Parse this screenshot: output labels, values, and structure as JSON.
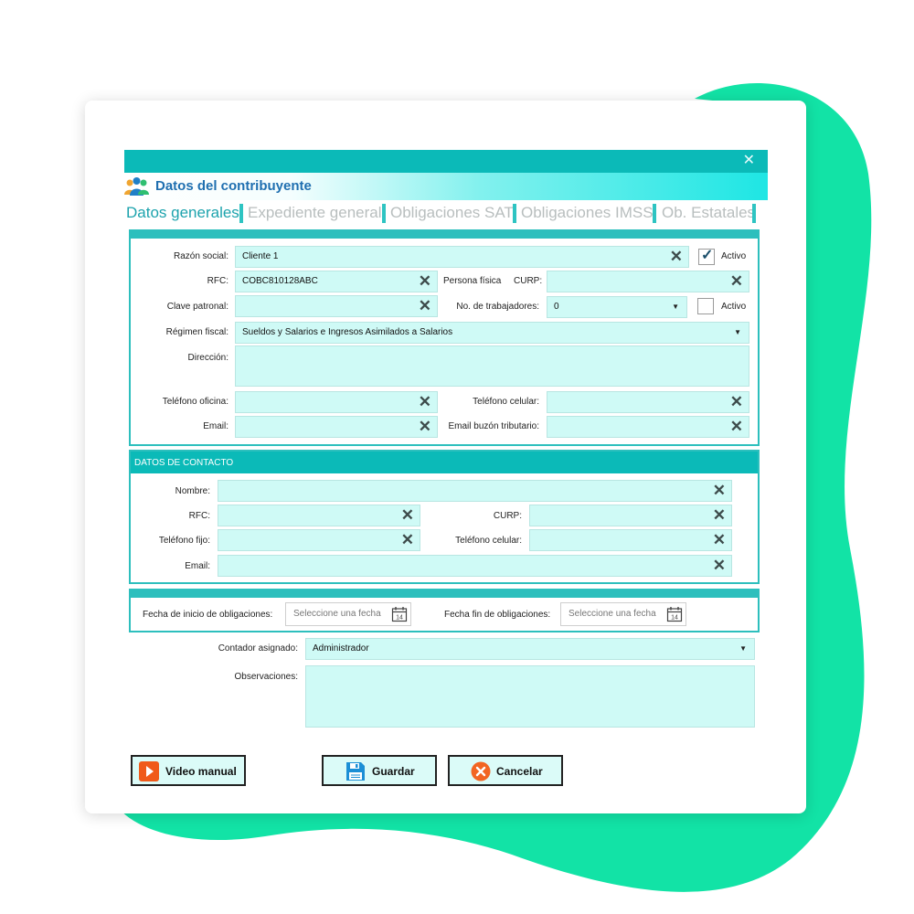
{
  "colors": {
    "accent": "#0bbab8",
    "field_bg": "#cffaf6",
    "blob": "#12e3a6",
    "title_blue": "#1f6fb0"
  },
  "window": {
    "close_icon": "close-icon",
    "title": "Datos del contribuyente",
    "title_icon": "people-group-icon"
  },
  "tabs": [
    {
      "label": "Datos generales",
      "active": true
    },
    {
      "label": "Expediente general",
      "active": false
    },
    {
      "label": "Obligaciones SAT",
      "active": false
    },
    {
      "label": "Obligaciones IMSS",
      "active": false
    },
    {
      "label": "Ob. Estatales",
      "active": false
    }
  ],
  "general": {
    "razon_social_label": "Razón social:",
    "razon_social_value": "Cliente 1",
    "activo_label": "Activo",
    "activo_checked": true,
    "rfc_label": "RFC:",
    "rfc_value": "COBC810128ABC",
    "persona_label": "Persona física",
    "curp_label": "CURP:",
    "curp_value": "",
    "clave_label": "Clave patronal:",
    "clave_value": "",
    "trabajadores_label": "No. de trabajadores:",
    "trabajadores_value": "0",
    "activo2_label": "Activo",
    "activo2_checked": false,
    "regimen_label": "Régimen fiscal:",
    "regimen_value": "Sueldos y Salarios e Ingresos Asimilados a Salarios",
    "direccion_label": "Dirección:",
    "direccion_value": "",
    "tel_oficina_label": "Teléfono oficina:",
    "tel_celular_label": "Teléfono celular:",
    "email_label": "Email:",
    "email_buzon_label": "Email buzón tributario:"
  },
  "contacto": {
    "section_title": "DATOS DE CONTACTO",
    "nombre_label": "Nombre:",
    "rfc_label": "RFC:",
    "curp_label": "CURP:",
    "tel_fijo_label": "Teléfono fijo:",
    "tel_celular_label": "Teléfono celular:",
    "email_label": "Email:"
  },
  "fechas": {
    "inicio_label": "Fecha de inicio de obligaciones:",
    "inicio_placeholder": "Seleccione una fecha",
    "fin_label": "Fecha fin de obligaciones:",
    "fin_placeholder": "Seleccione una fecha",
    "calendar_day": "14"
  },
  "extra": {
    "contador_label": "Contador asignado:",
    "contador_value": "Administrador",
    "observaciones_label": "Observaciones:",
    "observaciones_value": ""
  },
  "buttons": {
    "video": "Video manual",
    "guardar": "Guardar",
    "cancelar": "Cancelar"
  }
}
